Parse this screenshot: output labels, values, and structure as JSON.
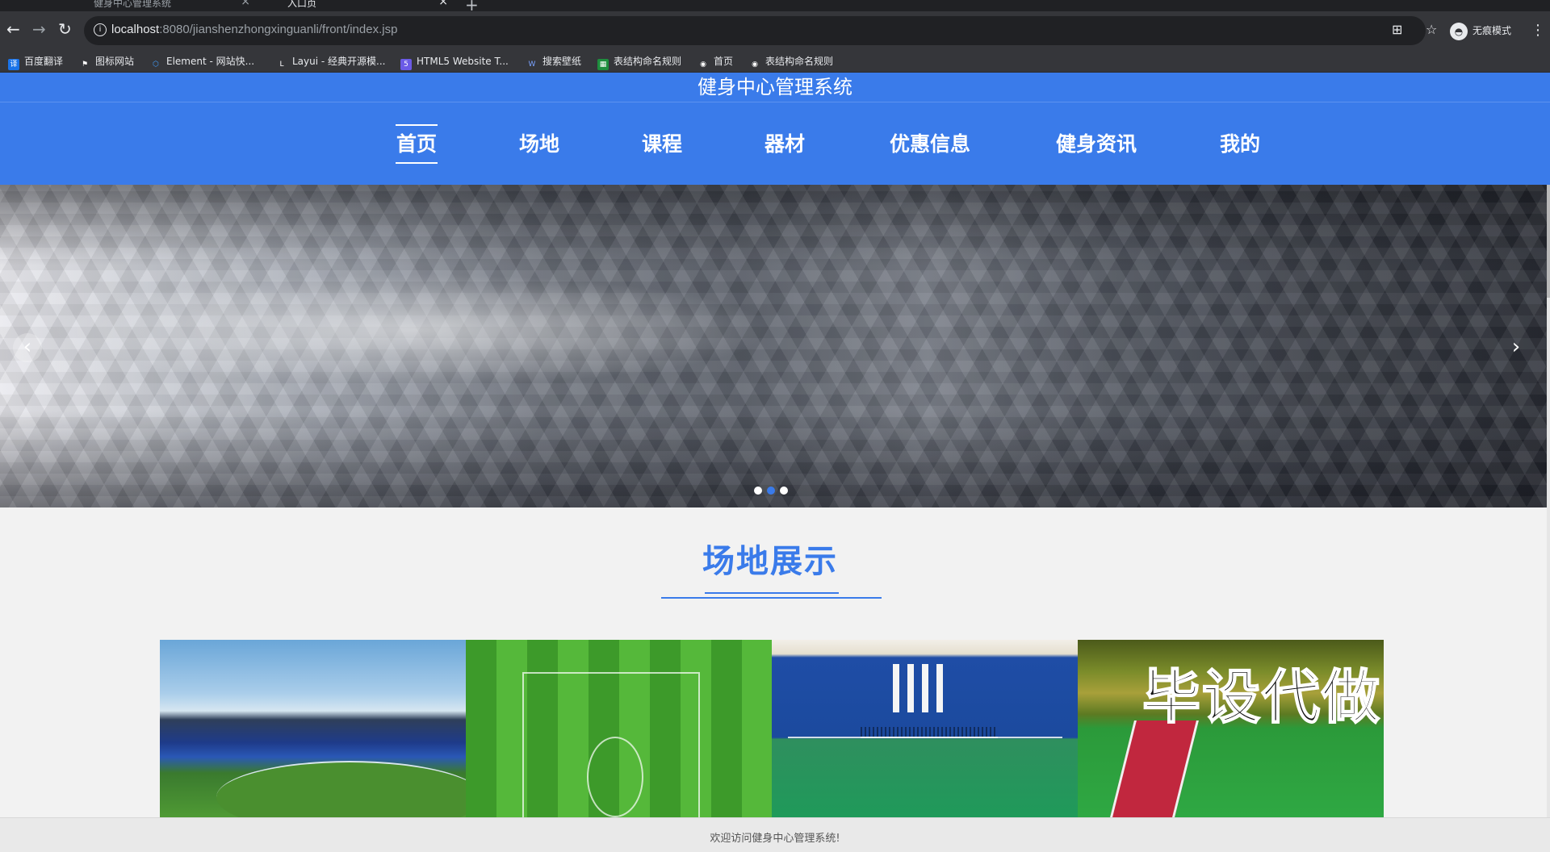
{
  "browser": {
    "tabs": [
      {
        "title": "健身中心管理系统",
        "close": "×"
      },
      {
        "title": "入口页",
        "close": "×"
      }
    ],
    "new_tab": "+",
    "nav": {
      "back": "←",
      "forward": "→",
      "reload": "↻"
    },
    "url_host": "localhost",
    "url_rest": ":8080/jianshenzhongxinguanli/front/index.jsp",
    "translate_icon": "⊞",
    "star_icon": "☆",
    "profile_label": "无痕模式",
    "menu_icon": "⋮",
    "bookmarks": [
      {
        "label": "百度翻译",
        "icon": "译",
        "color": "#1a73e8"
      },
      {
        "label": "图标网站",
        "icon": "⚑",
        "color": "#35363a"
      },
      {
        "label": "Element - 网站快...",
        "icon": "⬡",
        "color": "#409eff"
      },
      {
        "label": "Layui - 经典开源模...",
        "icon": "L",
        "color": "#35363a"
      },
      {
        "label": "HTML5 Website T...",
        "icon": "5",
        "color": "#6b5be6"
      },
      {
        "label": "搜索壁纸",
        "icon": "W",
        "color": "#3b5bdb"
      },
      {
        "label": "表结构命名规则",
        "icon": "▦",
        "color": "#1e8e3e"
      },
      {
        "label": "首页",
        "icon": "◉",
        "color": "#35363a"
      },
      {
        "label": "表结构命名规则",
        "icon": "◉",
        "color": "#35363a"
      }
    ]
  },
  "site": {
    "title": "健身中心管理系统",
    "nav": [
      {
        "label": "首页",
        "active": true
      },
      {
        "label": "场地",
        "active": false
      },
      {
        "label": "课程",
        "active": false
      },
      {
        "label": "器材",
        "active": false
      },
      {
        "label": "优惠信息",
        "active": false
      },
      {
        "label": "健身资讯",
        "active": false
      },
      {
        "label": "我的",
        "active": false
      }
    ],
    "carousel": {
      "prev": "‹",
      "next": "›",
      "slides": 3,
      "active_index": 1
    },
    "section_title": "场地展示",
    "gallery_watermark": "毕设代做",
    "footer": "欢迎访问健身中心管理系统!"
  }
}
